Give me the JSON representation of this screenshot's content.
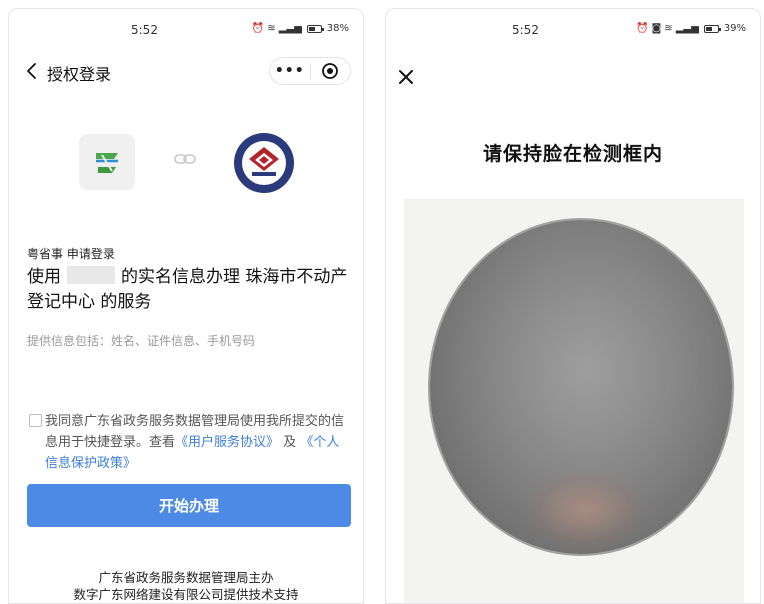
{
  "left": {
    "status": {
      "time": "5:52",
      "battery": "38%"
    },
    "nav": {
      "title": "授权登录",
      "more": "•••"
    },
    "request_label": "粤省事 申请登录",
    "main": {
      "prefix": "使用",
      "suffix": "的实名信息办理 珠海市不动产登记中心 的服务"
    },
    "info": "提供信息包括：姓名、证件信息、手机号码",
    "agreement": {
      "text1": "我同意广东省政务服务数据管理局使用我所提交的信息用于快捷登录。查看",
      "link1": "《用户服务协议》",
      "and": "及",
      "link2": "《个人信息保护政策》"
    },
    "button": "开始办理",
    "footer": {
      "line1": "广东省政务服务数据管理局主办",
      "line2": "数字广东网络建设有限公司提供技术支持"
    },
    "colors": {
      "button": "#4c8ae6",
      "link": "#3d7fd6"
    }
  },
  "right": {
    "status": {
      "time": "5:52",
      "battery": "39%"
    },
    "close": "×",
    "title": "请保持脸在检测框内"
  }
}
